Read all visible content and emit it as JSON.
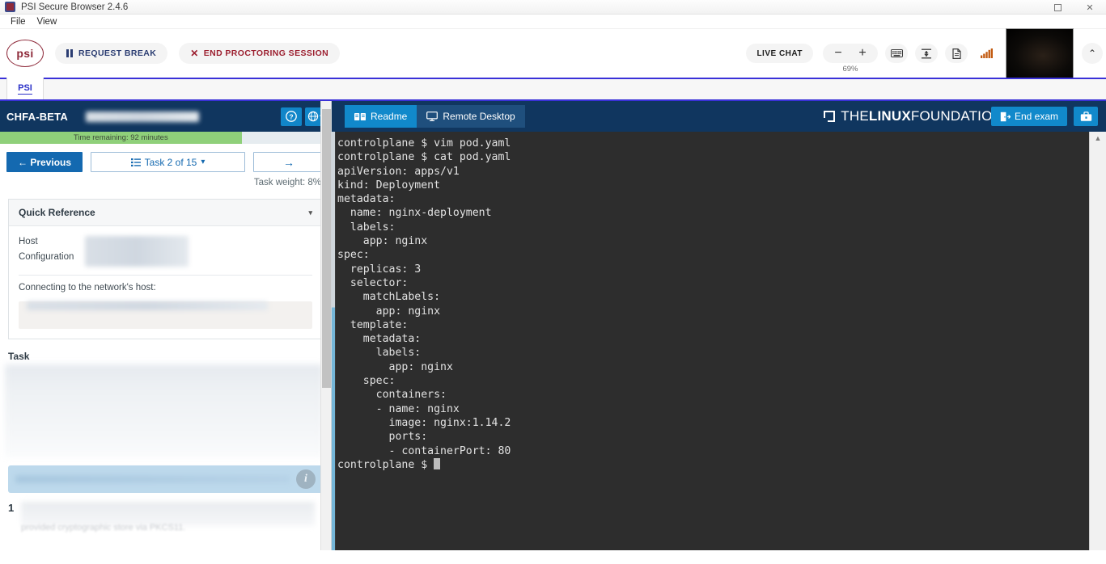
{
  "window": {
    "title": "PSI Secure Browser 2.4.6",
    "app_icon": "psi-app-icon",
    "maximize": "▢",
    "close": "✕"
  },
  "menubar": {
    "items": [
      "File",
      "View"
    ]
  },
  "proctor_toolbar": {
    "logo": "psi",
    "request_break": "REQUEST BREAK",
    "end_session": "END PROCTORING SESSION",
    "live_chat": "LIVE CHAT",
    "zoom_out": "−",
    "zoom_in": "+",
    "zoom_level": "69%",
    "icons": [
      "keyboard-icon",
      "screen-fit-icon",
      "document-icon",
      "signal-strength-icon"
    ],
    "collapse": "⌃"
  },
  "browser_tabs": {
    "tabs": [
      {
        "label": "PSI"
      }
    ]
  },
  "exam_panel": {
    "code": "CHFA-BETA",
    "exam_name": "",
    "help_icon": "?",
    "language_icon": "globe",
    "time_remaining": "Time remaining: 92 minutes",
    "previous": "← Previous",
    "task_selector": "Task 2 of 15",
    "task_selector_icon": "list-icon",
    "next": "→",
    "task_weight": "Task weight: 8%",
    "quick_reference": {
      "title": "Quick Reference",
      "collapse_caret": "▾",
      "host_label": "Host",
      "configuration_label": "Configuration",
      "connect_label": "Connecting to the network's host:"
    },
    "task": {
      "heading": "Task",
      "step_number": "1",
      "step_tail": "provided cryptographic store via PKCS11."
    }
  },
  "lab_panel": {
    "tabs": [
      {
        "label": "Readme",
        "icon": "book-icon",
        "active": true
      },
      {
        "label": "Remote Desktop",
        "icon": "monitor-icon",
        "active": false
      }
    ],
    "brand": {
      "the": "THE",
      "linux": "LINUX",
      "foundation": "FOUNDATION",
      "mark": "lf-square-icon"
    },
    "end_exam": "End exam",
    "end_exam_icon": "exit-door-icon",
    "briefcase_icon": "briefcase-icon",
    "scroll_up_icon": "▲"
  },
  "terminal": {
    "lines": [
      "controlplane $ vim pod.yaml",
      "controlplane $ cat pod.yaml",
      "apiVersion: apps/v1",
      "kind: Deployment",
      "metadata:",
      "  name: nginx-deployment",
      "  labels:",
      "    app: nginx",
      "spec:",
      "  replicas: 3",
      "  selector:",
      "    matchLabels:",
      "      app: nginx",
      "  template:",
      "    metadata:",
      "      labels:",
      "        app: nginx",
      "    spec:",
      "      containers:",
      "      - name: nginx",
      "        image: nginx:1.14.2",
      "        ports:",
      "        - containerPort: 80"
    ],
    "prompt": "controlplane $ "
  },
  "colors": {
    "header_navy": "#10365f",
    "accent_blue": "#1189cb",
    "link_blue": "#1469b0",
    "timer_green": "#8fd07a",
    "terminal_bg": "#2d2d2d",
    "terminal_fg": "#e2e2e2",
    "psi_maroon": "#8e2a3a",
    "tab_border_blue": "#3a31d8"
  }
}
